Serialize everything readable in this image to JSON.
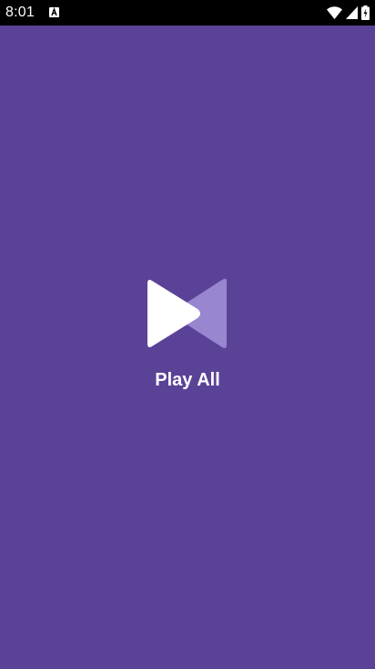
{
  "status_bar": {
    "time": "8:01",
    "notification_icon": "a-notification-icon",
    "wifi_icon": "wifi-icon",
    "signal_icon": "cell-signal-icon",
    "battery_icon": "battery-icon"
  },
  "splash": {
    "label": "Play All",
    "logo_icon": "play-logo-icon"
  },
  "colors": {
    "background": "#5a4296",
    "logo_primary": "#ffffff",
    "logo_secondary": "#9886d0",
    "status_bar": "#000000"
  }
}
